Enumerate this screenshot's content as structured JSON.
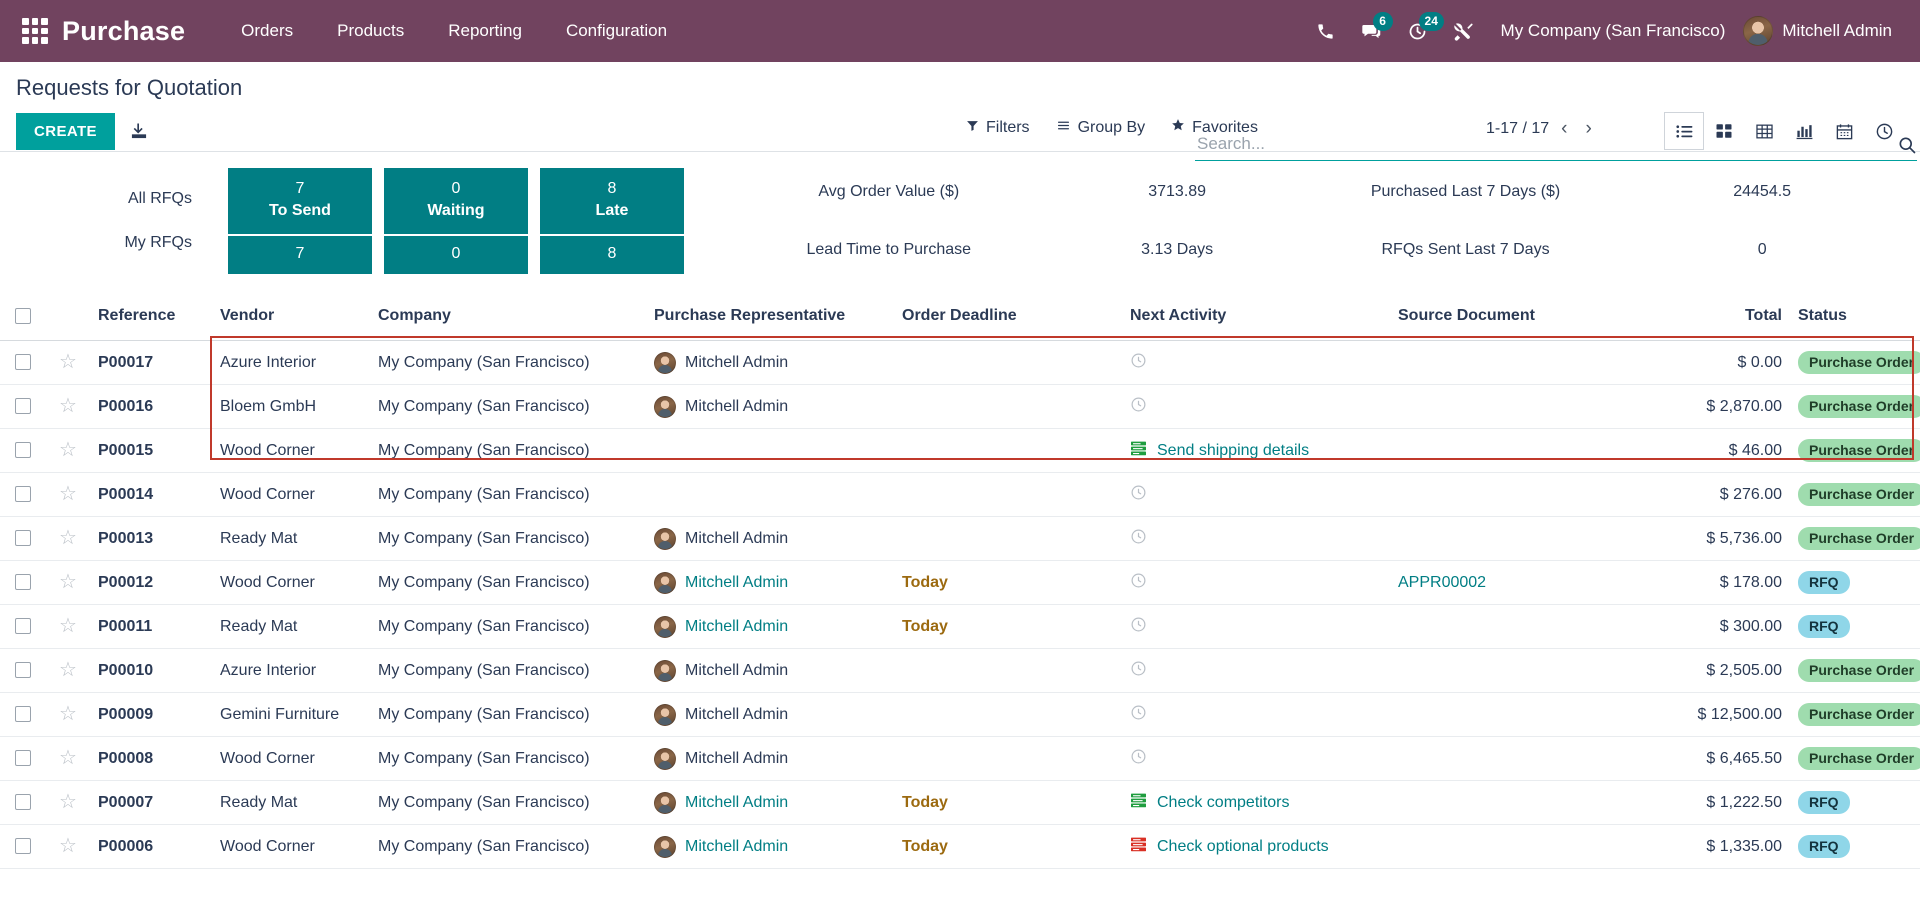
{
  "navbar": {
    "apps_icon": "apps-grid-icon",
    "brand": "Purchase",
    "menu": [
      "Orders",
      "Products",
      "Reporting",
      "Configuration"
    ],
    "icons": [
      {
        "name": "phone-icon",
        "badge": null
      },
      {
        "name": "chat-icon",
        "badge": "6"
      },
      {
        "name": "activity-clock-icon",
        "badge": "24"
      },
      {
        "name": "tools-icon",
        "badge": null
      }
    ],
    "company": "My Company (San Francisco)",
    "user": "Mitchell Admin"
  },
  "control_panel": {
    "title": "Requests for Quotation",
    "create_label": "CREATE",
    "import_icon": "import-download-icon",
    "search": {
      "value": "",
      "placeholder": "Search..."
    },
    "search_icon": "search-icon",
    "filters": [
      {
        "label": "Filters",
        "icon": "filter-icon"
      },
      {
        "label": "Group By",
        "icon": "group-by-icon"
      },
      {
        "label": "Favorites",
        "icon": "star-icon"
      }
    ],
    "pager": {
      "range": "1-17 / 17",
      "prev": "‹",
      "next": "›"
    },
    "views": [
      {
        "name": "list-view",
        "icon": "list-icon",
        "active": true
      },
      {
        "name": "kanban-view",
        "icon": "kanban-icon",
        "active": false
      },
      {
        "name": "pivot-view",
        "icon": "pivot-table-icon",
        "active": false
      },
      {
        "name": "graph-view",
        "icon": "bar-chart-icon",
        "active": false
      },
      {
        "name": "calendar-view",
        "icon": "calendar-icon",
        "active": false
      },
      {
        "name": "activity-view",
        "icon": "clock-icon",
        "active": false
      }
    ]
  },
  "dashboard": {
    "highlight_color": "#c0392b",
    "accent_color": "#017e84",
    "side": [
      "All RFQs",
      "My RFQs"
    ],
    "tiles": [
      {
        "top_value": "7",
        "label": "To Send",
        "bottom_value": "7"
      },
      {
        "top_value": "0",
        "label": "Waiting",
        "bottom_value": "0"
      },
      {
        "top_value": "8",
        "label": "Late",
        "bottom_value": "8"
      }
    ],
    "metrics": [
      {
        "label": "Avg Order Value ($)",
        "value": "3713.89"
      },
      {
        "label": "Purchased Last 7 Days ($)",
        "value": "24454.5"
      },
      {
        "label": "Lead Time to Purchase",
        "value": "3.13  Days"
      },
      {
        "label": "RFQs Sent Last 7 Days",
        "value": "0"
      }
    ]
  },
  "table": {
    "columns": [
      "Reference",
      "Vendor",
      "Company",
      "Purchase Representative",
      "Order Deadline",
      "Next Activity",
      "Source Document",
      "Total",
      "Status"
    ],
    "optional_icon": "options-dots-icon",
    "rows": [
      {
        "reference": "P00017",
        "vendor": "Azure Interior",
        "company": "My Company (San Francisco)",
        "rep": "Mitchell Admin",
        "has_avatar": true,
        "deadline": "",
        "activity": "",
        "activity_icon": "clock-icon",
        "activity_color": "",
        "source": "",
        "total": "$ 0.00",
        "status": "Purchase Order",
        "status_type": "po",
        "is_rfq": false
      },
      {
        "reference": "P00016",
        "vendor": "Bloem GmbH",
        "company": "My Company (San Francisco)",
        "rep": "Mitchell Admin",
        "has_avatar": true,
        "deadline": "",
        "activity": "",
        "activity_icon": "clock-icon",
        "activity_color": "",
        "source": "",
        "total": "$ 2,870.00",
        "status": "Purchase Order",
        "status_type": "po",
        "is_rfq": false
      },
      {
        "reference": "P00015",
        "vendor": "Wood Corner",
        "company": "My Company (San Francisco)",
        "rep": "",
        "has_avatar": false,
        "deadline": "",
        "activity": "Send shipping details",
        "activity_icon": "task-icon",
        "activity_color": "#1f9d3f",
        "source": "",
        "total": "$ 46.00",
        "status": "Purchase Order",
        "status_type": "po",
        "is_rfq": false
      },
      {
        "reference": "P00014",
        "vendor": "Wood Corner",
        "company": "My Company (San Francisco)",
        "rep": "",
        "has_avatar": false,
        "deadline": "",
        "activity": "",
        "activity_icon": "clock-icon",
        "activity_color": "",
        "source": "",
        "total": "$ 276.00",
        "status": "Purchase Order",
        "status_type": "po",
        "is_rfq": false
      },
      {
        "reference": "P00013",
        "vendor": "Ready Mat",
        "company": "My Company (San Francisco)",
        "rep": "Mitchell Admin",
        "has_avatar": true,
        "deadline": "",
        "activity": "",
        "activity_icon": "clock-icon",
        "activity_color": "",
        "source": "",
        "total": "$ 5,736.00",
        "status": "Purchase Order",
        "status_type": "po",
        "is_rfq": false
      },
      {
        "reference": "P00012",
        "vendor": "Wood Corner",
        "company": "My Company (San Francisco)",
        "rep": "Mitchell Admin",
        "has_avatar": true,
        "deadline": "Today",
        "activity": "",
        "activity_icon": "clock-icon",
        "activity_color": "",
        "source": "APPR00002",
        "total": "$ 178.00",
        "status": "RFQ",
        "status_type": "rfq",
        "is_rfq": true
      },
      {
        "reference": "P00011",
        "vendor": "Ready Mat",
        "company": "My Company (San Francisco)",
        "rep": "Mitchell Admin",
        "has_avatar": true,
        "deadline": "Today",
        "activity": "",
        "activity_icon": "clock-icon",
        "activity_color": "",
        "source": "",
        "total": "$ 300.00",
        "status": "RFQ",
        "status_type": "rfq",
        "is_rfq": true
      },
      {
        "reference": "P00010",
        "vendor": "Azure Interior",
        "company": "My Company (San Francisco)",
        "rep": "Mitchell Admin",
        "has_avatar": true,
        "deadline": "",
        "activity": "",
        "activity_icon": "clock-icon",
        "activity_color": "",
        "source": "",
        "total": "$ 2,505.00",
        "status": "Purchase Order",
        "status_type": "po",
        "is_rfq": false
      },
      {
        "reference": "P00009",
        "vendor": "Gemini Furniture",
        "company": "My Company (San Francisco)",
        "rep": "Mitchell Admin",
        "has_avatar": true,
        "deadline": "",
        "activity": "",
        "activity_icon": "clock-icon",
        "activity_color": "",
        "source": "",
        "total": "$ 12,500.00",
        "status": "Purchase Order",
        "status_type": "po",
        "is_rfq": false
      },
      {
        "reference": "P00008",
        "vendor": "Wood Corner",
        "company": "My Company (San Francisco)",
        "rep": "Mitchell Admin",
        "has_avatar": true,
        "deadline": "",
        "activity": "",
        "activity_icon": "clock-icon",
        "activity_color": "",
        "source": "",
        "total": "$ 6,465.50",
        "status": "Purchase Order",
        "status_type": "po",
        "is_rfq": false
      },
      {
        "reference": "P00007",
        "vendor": "Ready Mat",
        "company": "My Company (San Francisco)",
        "rep": "Mitchell Admin",
        "has_avatar": true,
        "deadline": "Today",
        "activity": "Check competitors",
        "activity_icon": "task-icon",
        "activity_color": "#1f9d3f",
        "source": "",
        "total": "$ 1,222.50",
        "status": "RFQ",
        "status_type": "rfq",
        "is_rfq": true
      },
      {
        "reference": "P00006",
        "vendor": "Wood Corner",
        "company": "My Company (San Francisco)",
        "rep": "Mitchell Admin",
        "has_avatar": true,
        "deadline": "Today",
        "activity": "Check optional products",
        "activity_icon": "task-icon",
        "activity_color": "#d93025",
        "source": "",
        "total": "$ 1,335.00",
        "status": "RFQ",
        "status_type": "rfq",
        "is_rfq": true
      }
    ]
  }
}
